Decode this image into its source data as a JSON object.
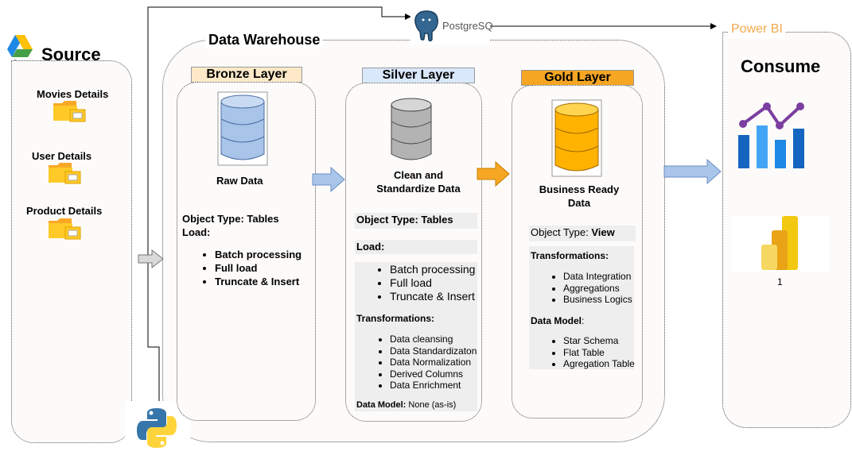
{
  "source": {
    "title": "Source",
    "items": [
      {
        "label": "Movies Details"
      },
      {
        "label": "User Details"
      },
      {
        "label": "Product Details"
      }
    ]
  },
  "warehouse": {
    "title": "Data Warehouse"
  },
  "postgres": {
    "label": "PostgreSQ"
  },
  "powerbi": {
    "label": "Power BI"
  },
  "bronze": {
    "badge": "Bronze Layer",
    "color": "#fde9c8",
    "caption": "Raw Data",
    "object_type": "Object Type: Tables",
    "load_label": "Load:",
    "load_items": [
      "Batch processing",
      "Full load",
      "Truncate & Insert"
    ]
  },
  "silver": {
    "badge": "Silver Layer",
    "color": "#dae8fc",
    "caption": "Clean and Standardize Data",
    "object_type": "Object Type: Tables",
    "load_label": "Load:",
    "load_items": [
      "Batch processing",
      "Full load",
      "Truncate & Insert"
    ],
    "transform_label": "Transformations:",
    "transform_items": [
      "Data cleansing",
      "Data Standardizaton",
      "Data Normalization",
      "Derived Columns",
      "Data Enrichment"
    ],
    "model_label": "Data Model:",
    "model_value": " None (as-is)"
  },
  "gold": {
    "badge": "Gold Layer",
    "color": "#f5a623",
    "caption": "Business Ready Data",
    "object_type_label": "Object Type: ",
    "object_type_value": "View",
    "transform_label": "Transformations:",
    "transform_items": [
      "Data Integration",
      "Aggregations",
      "Business Logics"
    ],
    "model_label": "Data Model",
    "model_suffix": ":",
    "model_items": [
      "Star Schema",
      "Flat Table",
      "Agregation Table"
    ]
  },
  "consume": {
    "title": "Consume",
    "powerbi_caption": "1"
  }
}
